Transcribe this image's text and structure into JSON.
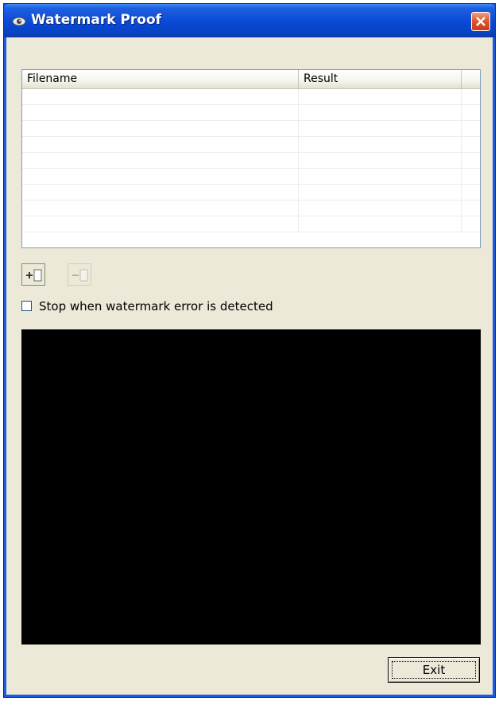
{
  "window": {
    "title": "Watermark Proof",
    "app_icon": "eye-icon",
    "close_icon": "close-icon"
  },
  "file_list": {
    "columns": [
      "Filename",
      "Result"
    ],
    "row_count_visible": 9,
    "rows": []
  },
  "toolbar": {
    "add_icon": "add-file-icon",
    "remove_icon": "remove-file-icon",
    "remove_enabled": false
  },
  "options": {
    "stop_on_error_label": "Stop when watermark error is detected",
    "stop_on_error_checked": false
  },
  "console": {
    "text": ""
  },
  "footer": {
    "exit_label": "Exit"
  },
  "colors": {
    "titlebar": "#0a49d6",
    "window_bg": "#ece9d8",
    "close_button": "#e2582e",
    "console_bg": "#000000"
  }
}
